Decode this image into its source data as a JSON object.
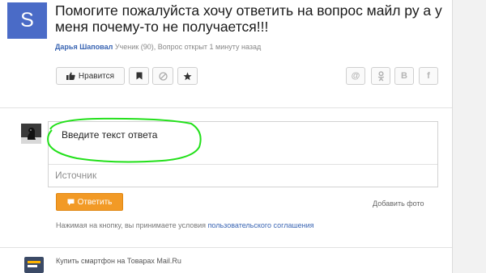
{
  "question": {
    "avatar_letter": "S",
    "title": "Помогите пожалуйста хочу ответить на вопрос майл ру а у меня почему-то не получается!!!",
    "author": "Дарья Шаповал",
    "meta": "Ученик (90), Вопрос открыт 1 минуту назад"
  },
  "actions": {
    "like_label": "Нравится",
    "flag_icon": "bookmark-icon",
    "ban_icon": "block-icon",
    "star_icon": "star-icon"
  },
  "share": {
    "mail": "@",
    "ok": "ok-icon",
    "vk": "В",
    "fb": "f"
  },
  "answer_form": {
    "placeholder": "Введите текст ответа",
    "source_placeholder": "Источник",
    "submit_label": "Ответить",
    "add_photo": "Добавить фото",
    "terms_prefix": "Нажимая на кнопку, вы принимаете условия",
    "terms_link": "пользовательского соглашения"
  },
  "promo": {
    "text": "Купить смартфон на Товарах Mail.Ru"
  },
  "colors": {
    "accent_orange": "#f29a26",
    "link_blue": "#3a65b3",
    "avatar_blue": "#4a6bc7",
    "annotation_green": "#22e01a"
  }
}
